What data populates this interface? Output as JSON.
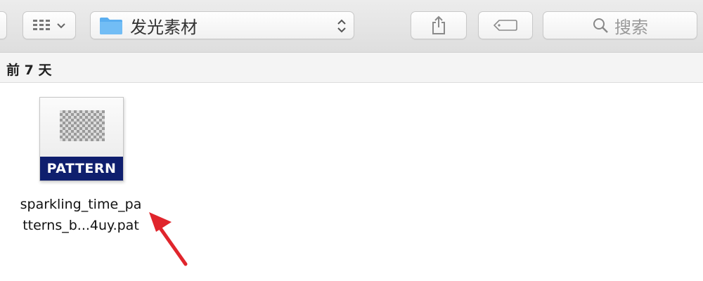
{
  "toolbar": {
    "view_toggle_icon": "grid-view-icon",
    "current_folder": "发光素材",
    "search_placeholder": "搜索"
  },
  "section": {
    "title": "前 7 天"
  },
  "files": [
    {
      "badge": "PATTERN",
      "name_line1": "sparkling_time_pa",
      "name_line2": "tterns_b...4uy.pat"
    }
  ],
  "colors": {
    "accent_badge": "#0f1f6e",
    "folder_blue": "#5aaef0",
    "annotation_arrow": "#e0252c"
  }
}
